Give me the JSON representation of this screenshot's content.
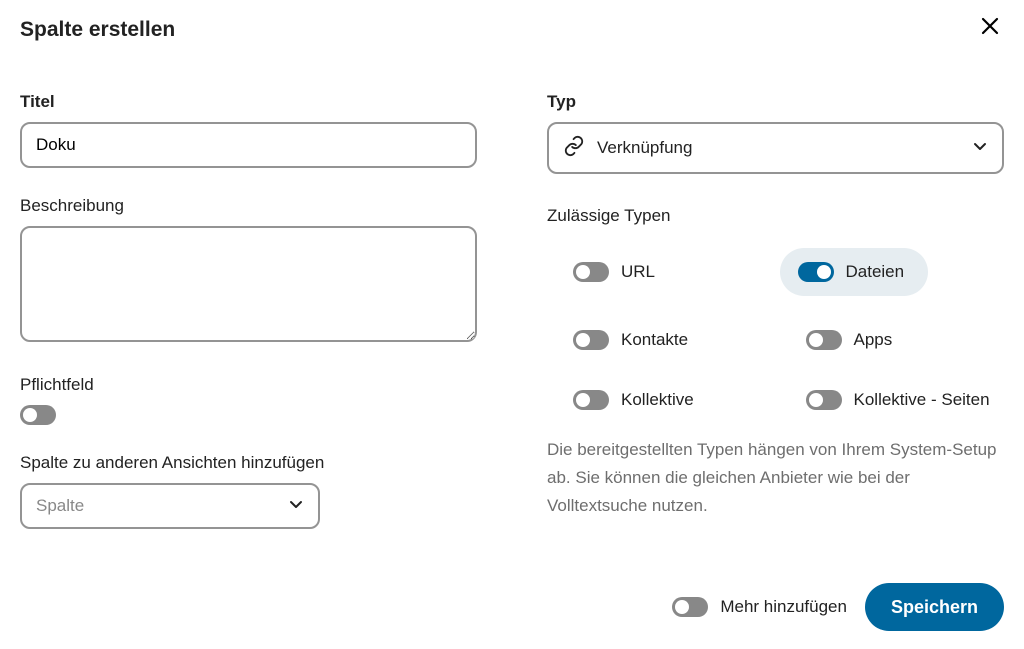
{
  "dialog": {
    "title": "Spalte erstellen"
  },
  "left": {
    "title_label": "Titel",
    "title_value": "Doku",
    "description_label": "Beschreibung",
    "description_value": "",
    "mandatory_label": "Pflichtfeld",
    "mandatory_on": false,
    "add_to_views_label": "Spalte zu anderen Ansichten hinzufügen",
    "add_to_views_placeholder": "Spalte"
  },
  "right": {
    "type_label": "Typ",
    "type_value": "Verknüpfung",
    "allowed_label": "Zulässige Typen",
    "allowed_types": [
      {
        "key": "url",
        "label": "URL",
        "on": false
      },
      {
        "key": "dateien",
        "label": "Dateien",
        "on": true
      },
      {
        "key": "kontakte",
        "label": "Kontakte",
        "on": false
      },
      {
        "key": "apps",
        "label": "Apps",
        "on": false
      },
      {
        "key": "kollektive",
        "label": "Kollektive",
        "on": false
      },
      {
        "key": "kollektive-seiten",
        "label": "Kollektive - Seiten",
        "on": false
      }
    ],
    "help_text": "Die bereitgestellten Typen hängen von Ihrem System-Setup ab. Sie können die gleichen Anbieter wie bei der Volltextsuche nutzen."
  },
  "footer": {
    "add_more_label": "Mehr hinzufügen",
    "add_more_on": false,
    "save_label": "Speichern"
  }
}
